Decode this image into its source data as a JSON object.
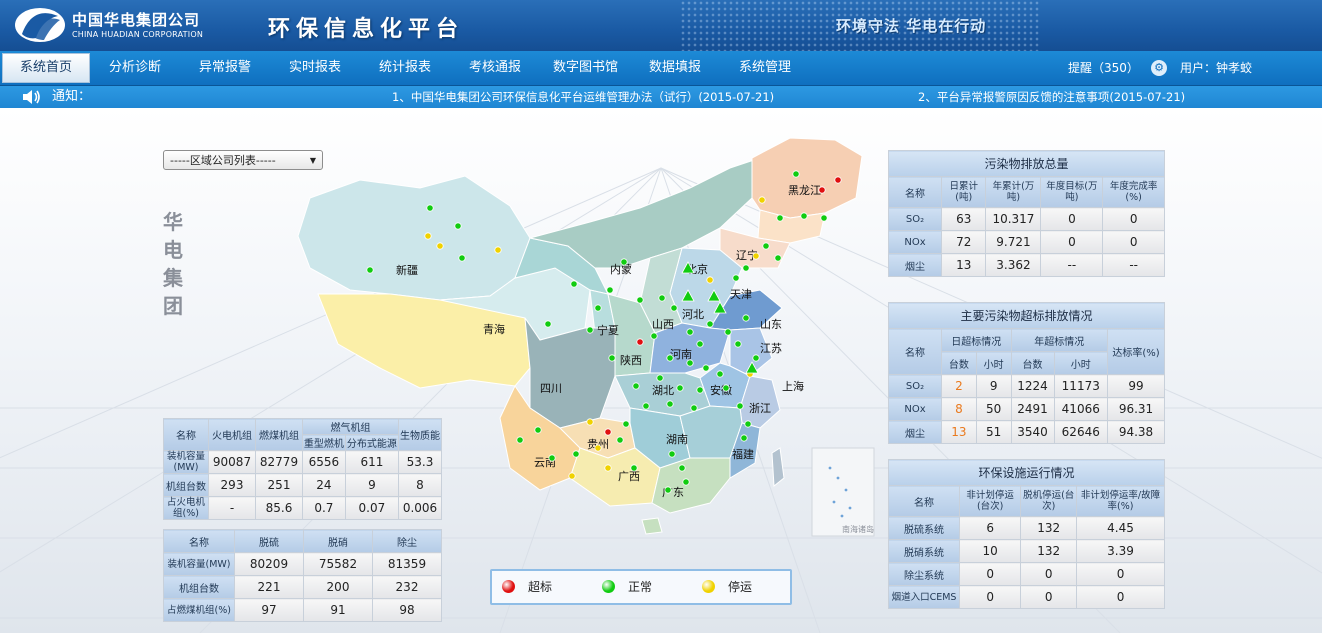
{
  "header": {
    "brand_cn": "中国华电集团公司",
    "brand_en": "CHINA HUADIAN CORPORATION",
    "app_title": "环保信息化平台",
    "slogan": "环境守法 华电在行动"
  },
  "nav": {
    "items": [
      "系统首页",
      "分析诊断",
      "异常报警",
      "实时报表",
      "统计报表",
      "考核通报",
      "数字图书馆",
      "数据填报",
      "系统管理"
    ],
    "active": "系统首页",
    "remind": "提醒（350）",
    "user": "用户：钟孝蛟"
  },
  "notice": {
    "label": "通知：",
    "items": [
      "1、中国华电集团公司环保信息化平台运维管理办法（试行）(2015-07-21)",
      "2、平台异常报警原因反馈的注意事项(2015-07-21)"
    ]
  },
  "region_select": {
    "value": "-----区域公司列表-----"
  },
  "group_title": [
    "华",
    "电",
    "集",
    "团"
  ],
  "map": {
    "provinces": [
      "黑龙江",
      "内蒙",
      "北京",
      "辽宁",
      "天津",
      "新疆",
      "宁夏",
      "山西",
      "河北",
      "山东",
      "青海",
      "陕西",
      "河南",
      "江苏",
      "四川",
      "湖北",
      "安徽",
      "上海",
      "浙江",
      "贵州",
      "湖南",
      "云南",
      "广西",
      "福建",
      "广东"
    ],
    "inset_label": "南海诸岛"
  },
  "legend": [
    {
      "label": "超标",
      "color": "#e01010"
    },
    {
      "label": "正常",
      "color": "#11cc11"
    },
    {
      "label": "停运",
      "color": "#f0d200"
    }
  ],
  "capacity_table": {
    "headers": [
      "名称",
      "火电机组",
      "燃煤机组",
      "燃气机组",
      "生物质能"
    ],
    "sub_headers": [
      "重型燃机",
      "分布式能源"
    ],
    "rows": [
      {
        "name": "装机容量(MW)",
        "values": [
          "90087",
          "82779",
          "6556",
          "611",
          "53.3"
        ]
      },
      {
        "name": "机组台数",
        "values": [
          "293",
          "251",
          "24",
          "9",
          "8"
        ]
      },
      {
        "name": "占火电机组(%)",
        "values": [
          "-",
          "85.6",
          "0.7",
          "0.07",
          "0.006"
        ]
      }
    ]
  },
  "treatment_table": {
    "headers": [
      "名称",
      "脱硫",
      "脱硝",
      "除尘"
    ],
    "rows": [
      {
        "name": "装机容量(MW)",
        "values": [
          "80209",
          "75582",
          "81359"
        ]
      },
      {
        "name": "机组台数",
        "values": [
          "221",
          "200",
          "232"
        ]
      },
      {
        "name": "占燃煤机组(%)",
        "values": [
          "97",
          "91",
          "98"
        ]
      }
    ]
  },
  "emission_table": {
    "title": "污染物排放总量",
    "headers": [
      "名称",
      "日累计(吨)",
      "年累计(万吨)",
      "年度目标(万吨)",
      "年度完成率(%)"
    ],
    "rows": [
      {
        "name": "SO₂",
        "values": [
          "63",
          "10.317",
          "0",
          "0"
        ]
      },
      {
        "name": "NOx",
        "values": [
          "72",
          "9.721",
          "0",
          "0"
        ]
      },
      {
        "name": "烟尘",
        "values": [
          "13",
          "3.362",
          "--",
          "--"
        ]
      }
    ]
  },
  "exceed_table": {
    "title": "主要污染物超标排放情况",
    "headers": [
      "名称",
      "日超标情况",
      "年超标情况",
      "达标率(%)"
    ],
    "sub_headers": [
      "台数",
      "小时",
      "台数",
      "小时"
    ],
    "rows": [
      {
        "name": "SO₂",
        "values": [
          "2",
          "9",
          "1224",
          "11173",
          "99"
        ]
      },
      {
        "name": "NOx",
        "values": [
          "8",
          "50",
          "2491",
          "41066",
          "96.31"
        ]
      },
      {
        "name": "烟尘",
        "values": [
          "13",
          "51",
          "3540",
          "62646",
          "94.38"
        ]
      }
    ]
  },
  "facility_table": {
    "title": "环保设施运行情况",
    "headers": [
      "名称",
      "非计划停运(台次)",
      "脱机停运(台次)",
      "非计划停运率/故障率(%)"
    ],
    "rows": [
      {
        "name": "脱硫系统",
        "values": [
          "6",
          "132",
          "4.45"
        ]
      },
      {
        "name": "脱硝系统",
        "values": [
          "10",
          "132",
          "3.39"
        ]
      },
      {
        "name": "除尘系统",
        "values": [
          "0",
          "0",
          "0"
        ]
      },
      {
        "name": "烟道入口CEMS",
        "values": [
          "0",
          "0",
          "0"
        ]
      }
    ]
  }
}
